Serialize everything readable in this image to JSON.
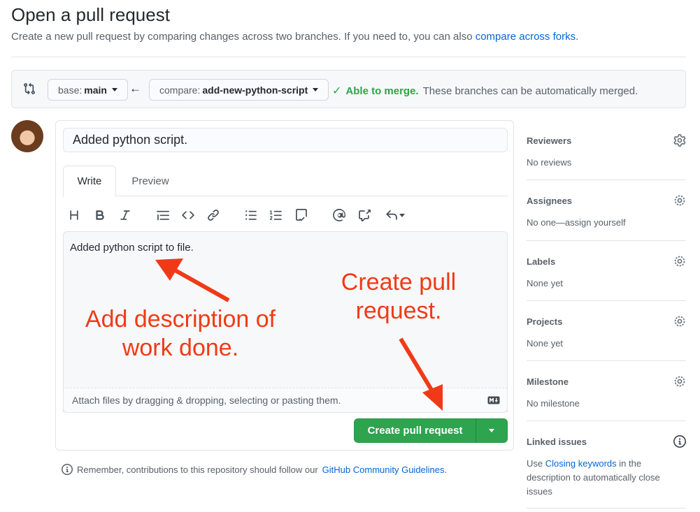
{
  "header": {
    "title": "Open a pull request",
    "subtitle_prefix": "Create a new pull request by comparing changes across two branches. If you need to, you can also",
    "subtitle_link": "compare across forks",
    "subtitle_suffix": "."
  },
  "range": {
    "base_label": "base:",
    "base_value": "main",
    "compare_label": "compare:",
    "compare_value": "add-new-python-script",
    "merge_ok": "Able to merge.",
    "merge_text": "These branches can be automatically merged."
  },
  "form": {
    "title_value": "Added python script.",
    "tabs": [
      "Write",
      "Preview"
    ],
    "body_text": "Added python script to file.",
    "attach_text": "Attach files by dragging & dropping, selecting or pasting them.",
    "submit_label": "Create pull request"
  },
  "footer": {
    "guidelines_prefix": "Remember, contributions to this repository should follow our",
    "guidelines_link": "GitHub Community Guidelines",
    "guidelines_suffix": "."
  },
  "sidebar": {
    "reviewers": {
      "title": "Reviewers",
      "value": "No reviews"
    },
    "assignees": {
      "title": "Assignees",
      "value": "No one—assign yourself"
    },
    "labels": {
      "title": "Labels",
      "value": "None yet"
    },
    "projects": {
      "title": "Projects",
      "value": "None yet"
    },
    "milestone": {
      "title": "Milestone",
      "value": "No milestone"
    },
    "linked": {
      "title": "Linked issues",
      "prefix": "Use",
      "link": "Closing keywords",
      "suffix": "in the description to automatically close issues"
    }
  },
  "annotations": {
    "left_line1": "Add description of",
    "left_line2": "work done.",
    "right_line1": "Create pull",
    "right_line2": "request."
  },
  "colors": {
    "accent_link": "#0366d6",
    "success_green": "#2ea44f",
    "annotation_red": "#f03a17"
  }
}
